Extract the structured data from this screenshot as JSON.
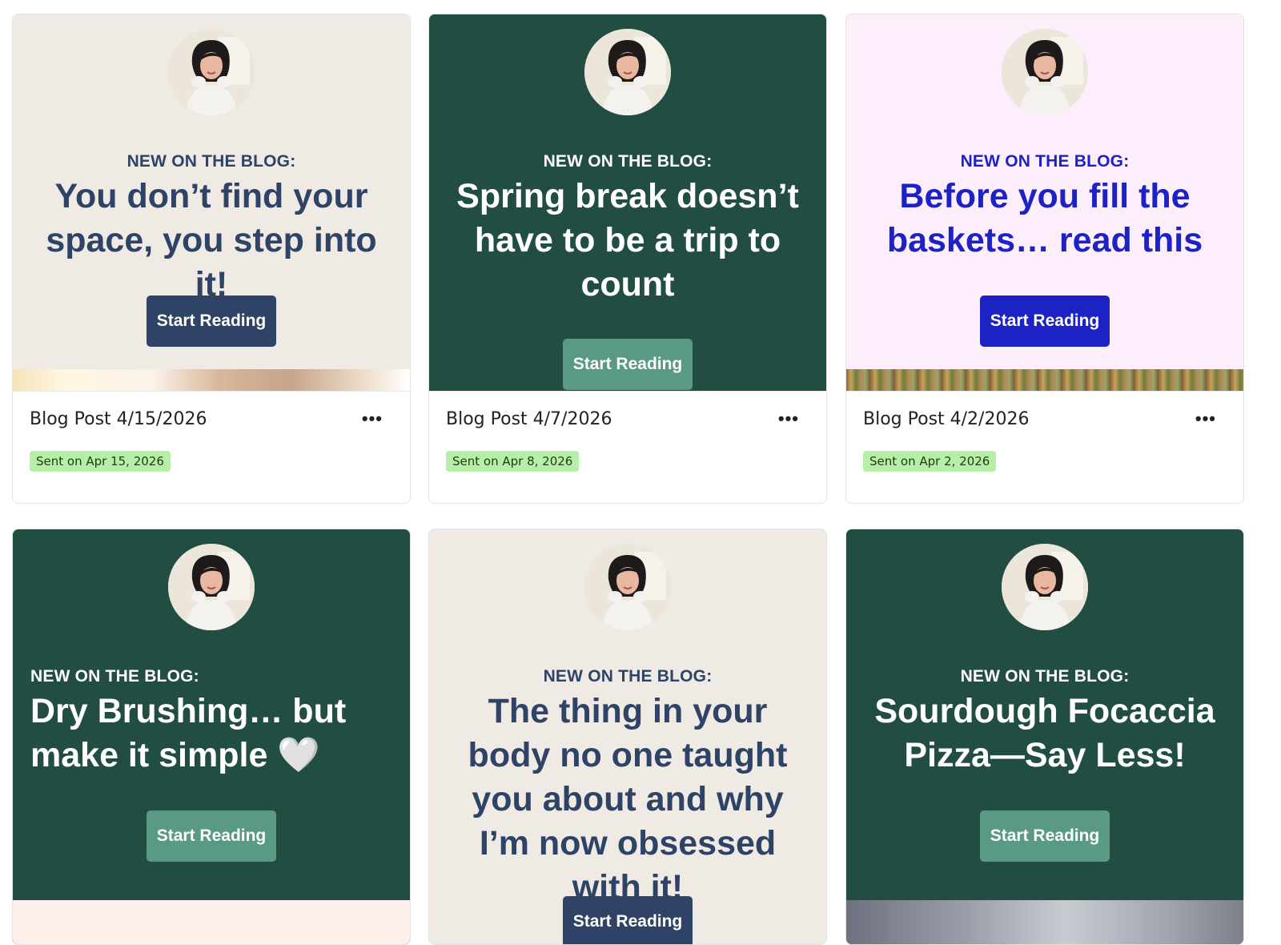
{
  "colors": {
    "cream_bg": "#efebe4",
    "green_bg": "#214d42",
    "pink_bg": "#fdeefc",
    "navy_text": "#2e4365",
    "blue_text": "#1d22c4",
    "green_button": "#5a9a85",
    "navy_button": "#2e4365",
    "blue_button": "#1d22c4",
    "badge_bg": "#b8efa8"
  },
  "cards": [
    {
      "kicker": "NEW ON THE BLOG:",
      "headline": "You don’t find your space, you step into it!",
      "cta": "Start Reading",
      "title": "Blog Post 4/15/2026",
      "status": "Sent on Apr 15, 2026",
      "more": "•••"
    },
    {
      "kicker": "NEW ON THE BLOG:",
      "headline": "Spring break doesn’t have to be a trip to count",
      "cta": "Start Reading",
      "title": "Blog Post 4/7/2026",
      "status": "Sent on Apr 8, 2026",
      "more": "•••"
    },
    {
      "kicker": "NEW ON THE BLOG:",
      "headline": "Before you fill the baskets… read this",
      "cta": "Start Reading",
      "title": "Blog Post 4/2/2026",
      "status": "Sent on Apr 2, 2026",
      "more": "•••"
    },
    {
      "kicker": "NEW ON THE BLOG:",
      "headline": "Dry Brushing… but make it simple 🤍",
      "cta": "Start Reading"
    },
    {
      "kicker": "NEW ON THE BLOG:",
      "headline": "The thing in your body no one taught you about and why I’m now obsessed with it!",
      "cta": "Start Reading"
    },
    {
      "kicker": "NEW ON THE BLOG:",
      "headline": "Sourdough Focaccia Pizza—Say Less!",
      "cta": "Start Reading"
    }
  ]
}
